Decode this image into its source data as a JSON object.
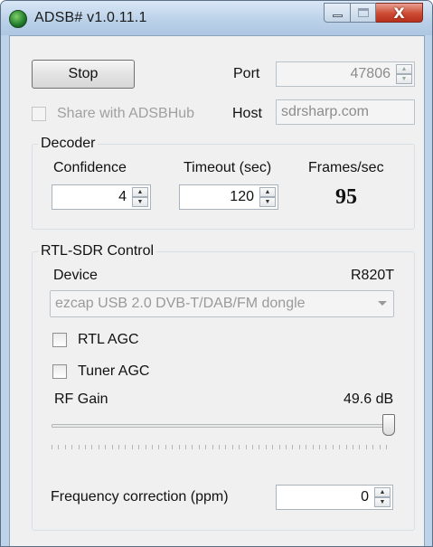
{
  "window": {
    "title": "ADSB# v1.0.11.1",
    "close_glyph": "X"
  },
  "main": {
    "stop_label": "Stop",
    "port_label": "Port",
    "port_value": "47806",
    "share_label": "Share with ADSBHub",
    "share_checked": false,
    "host_label": "Host",
    "host_value": "sdrsharp.com"
  },
  "decoder": {
    "title": "Decoder",
    "confidence_label": "Confidence",
    "confidence_value": "4",
    "timeout_label": "Timeout (sec)",
    "timeout_value": "120",
    "frames_label": "Frames/sec",
    "frames_value": "95"
  },
  "rtl": {
    "title": "RTL-SDR Control",
    "device_label": "Device",
    "device_model": "R820T",
    "device_selected": "ezcap USB 2.0 DVB-T/DAB/FM dongle",
    "rtl_agc_label": "RTL AGC",
    "rtl_agc_checked": false,
    "tuner_agc_label": "Tuner AGC",
    "tuner_agc_checked": false,
    "rf_gain_label": "RF Gain",
    "rf_gain_value": "49.6 dB",
    "rf_gain_slider_fraction": 1.0,
    "freq_corr_label": "Frequency correction (ppm)",
    "freq_corr_value": "0"
  },
  "icons": {
    "app": "adsb-app-icon",
    "spin_up": "▲",
    "spin_down": "▼"
  },
  "colors": {
    "titlebar": "#bcd3ea",
    "client_bg": "#f0f0f0",
    "close_button": "#cd4a33"
  }
}
